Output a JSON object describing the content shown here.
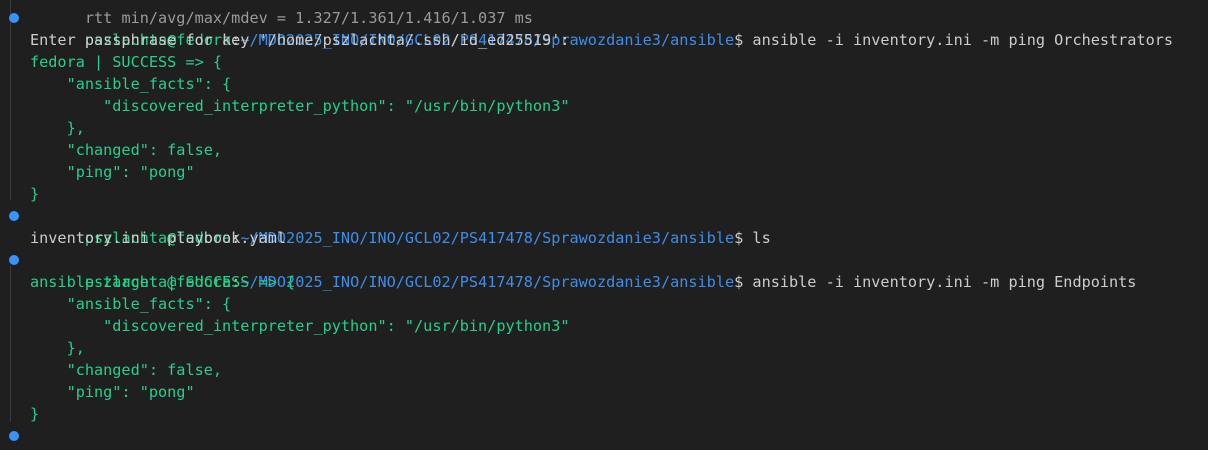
{
  "prompt": {
    "user_host": "pszlachta@fedora",
    "separator": ":",
    "path": "~/MDO2025_INO/INO/GCL02/PS417478/Sprawozdanie3/ansible",
    "symbol": "$"
  },
  "partial_top_line": "rtt min/avg/max/mdev = 1.327/1.361/1.416/1.037 ms",
  "commands": {
    "ping_orchestrators": "ansible -i inventory.ini -m ping Orchestrators",
    "ls": "ls",
    "ping_endpoints": "ansible -i inventory.ini -m ping Endpoints"
  },
  "output": {
    "passphrase_prompt": "Enter passphrase for key '/home/pszlachta/.ssh/id_ed25519':",
    "fedora_result": {
      "header": "fedora | SUCCESS => {",
      "facts_open": "    \"ansible_facts\": {",
      "interpreter": "        \"discovered_interpreter_python\": \"/usr/bin/python3\"",
      "facts_close": "    },",
      "changed": "    \"changed\": false,",
      "ping": "    \"ping\": \"pong\"",
      "close": "}"
    },
    "ls_listing": "inventory.ini  playbook.yaml",
    "target_result": {
      "header": "ansible-target | SUCCESS => {",
      "facts_open": "    \"ansible_facts\": {",
      "interpreter": "        \"discovered_interpreter_python\": \"/usr/bin/python3\"",
      "facts_close": "    },",
      "changed": "    \"changed\": false,",
      "ping": "    \"ping\": \"pong\"",
      "close": "}"
    }
  },
  "colors": {
    "background": "#1f1f1f",
    "green": "#23d18b",
    "blue_path": "#3b8eea",
    "dot": "#3794ff",
    "text": "#cccccc"
  }
}
